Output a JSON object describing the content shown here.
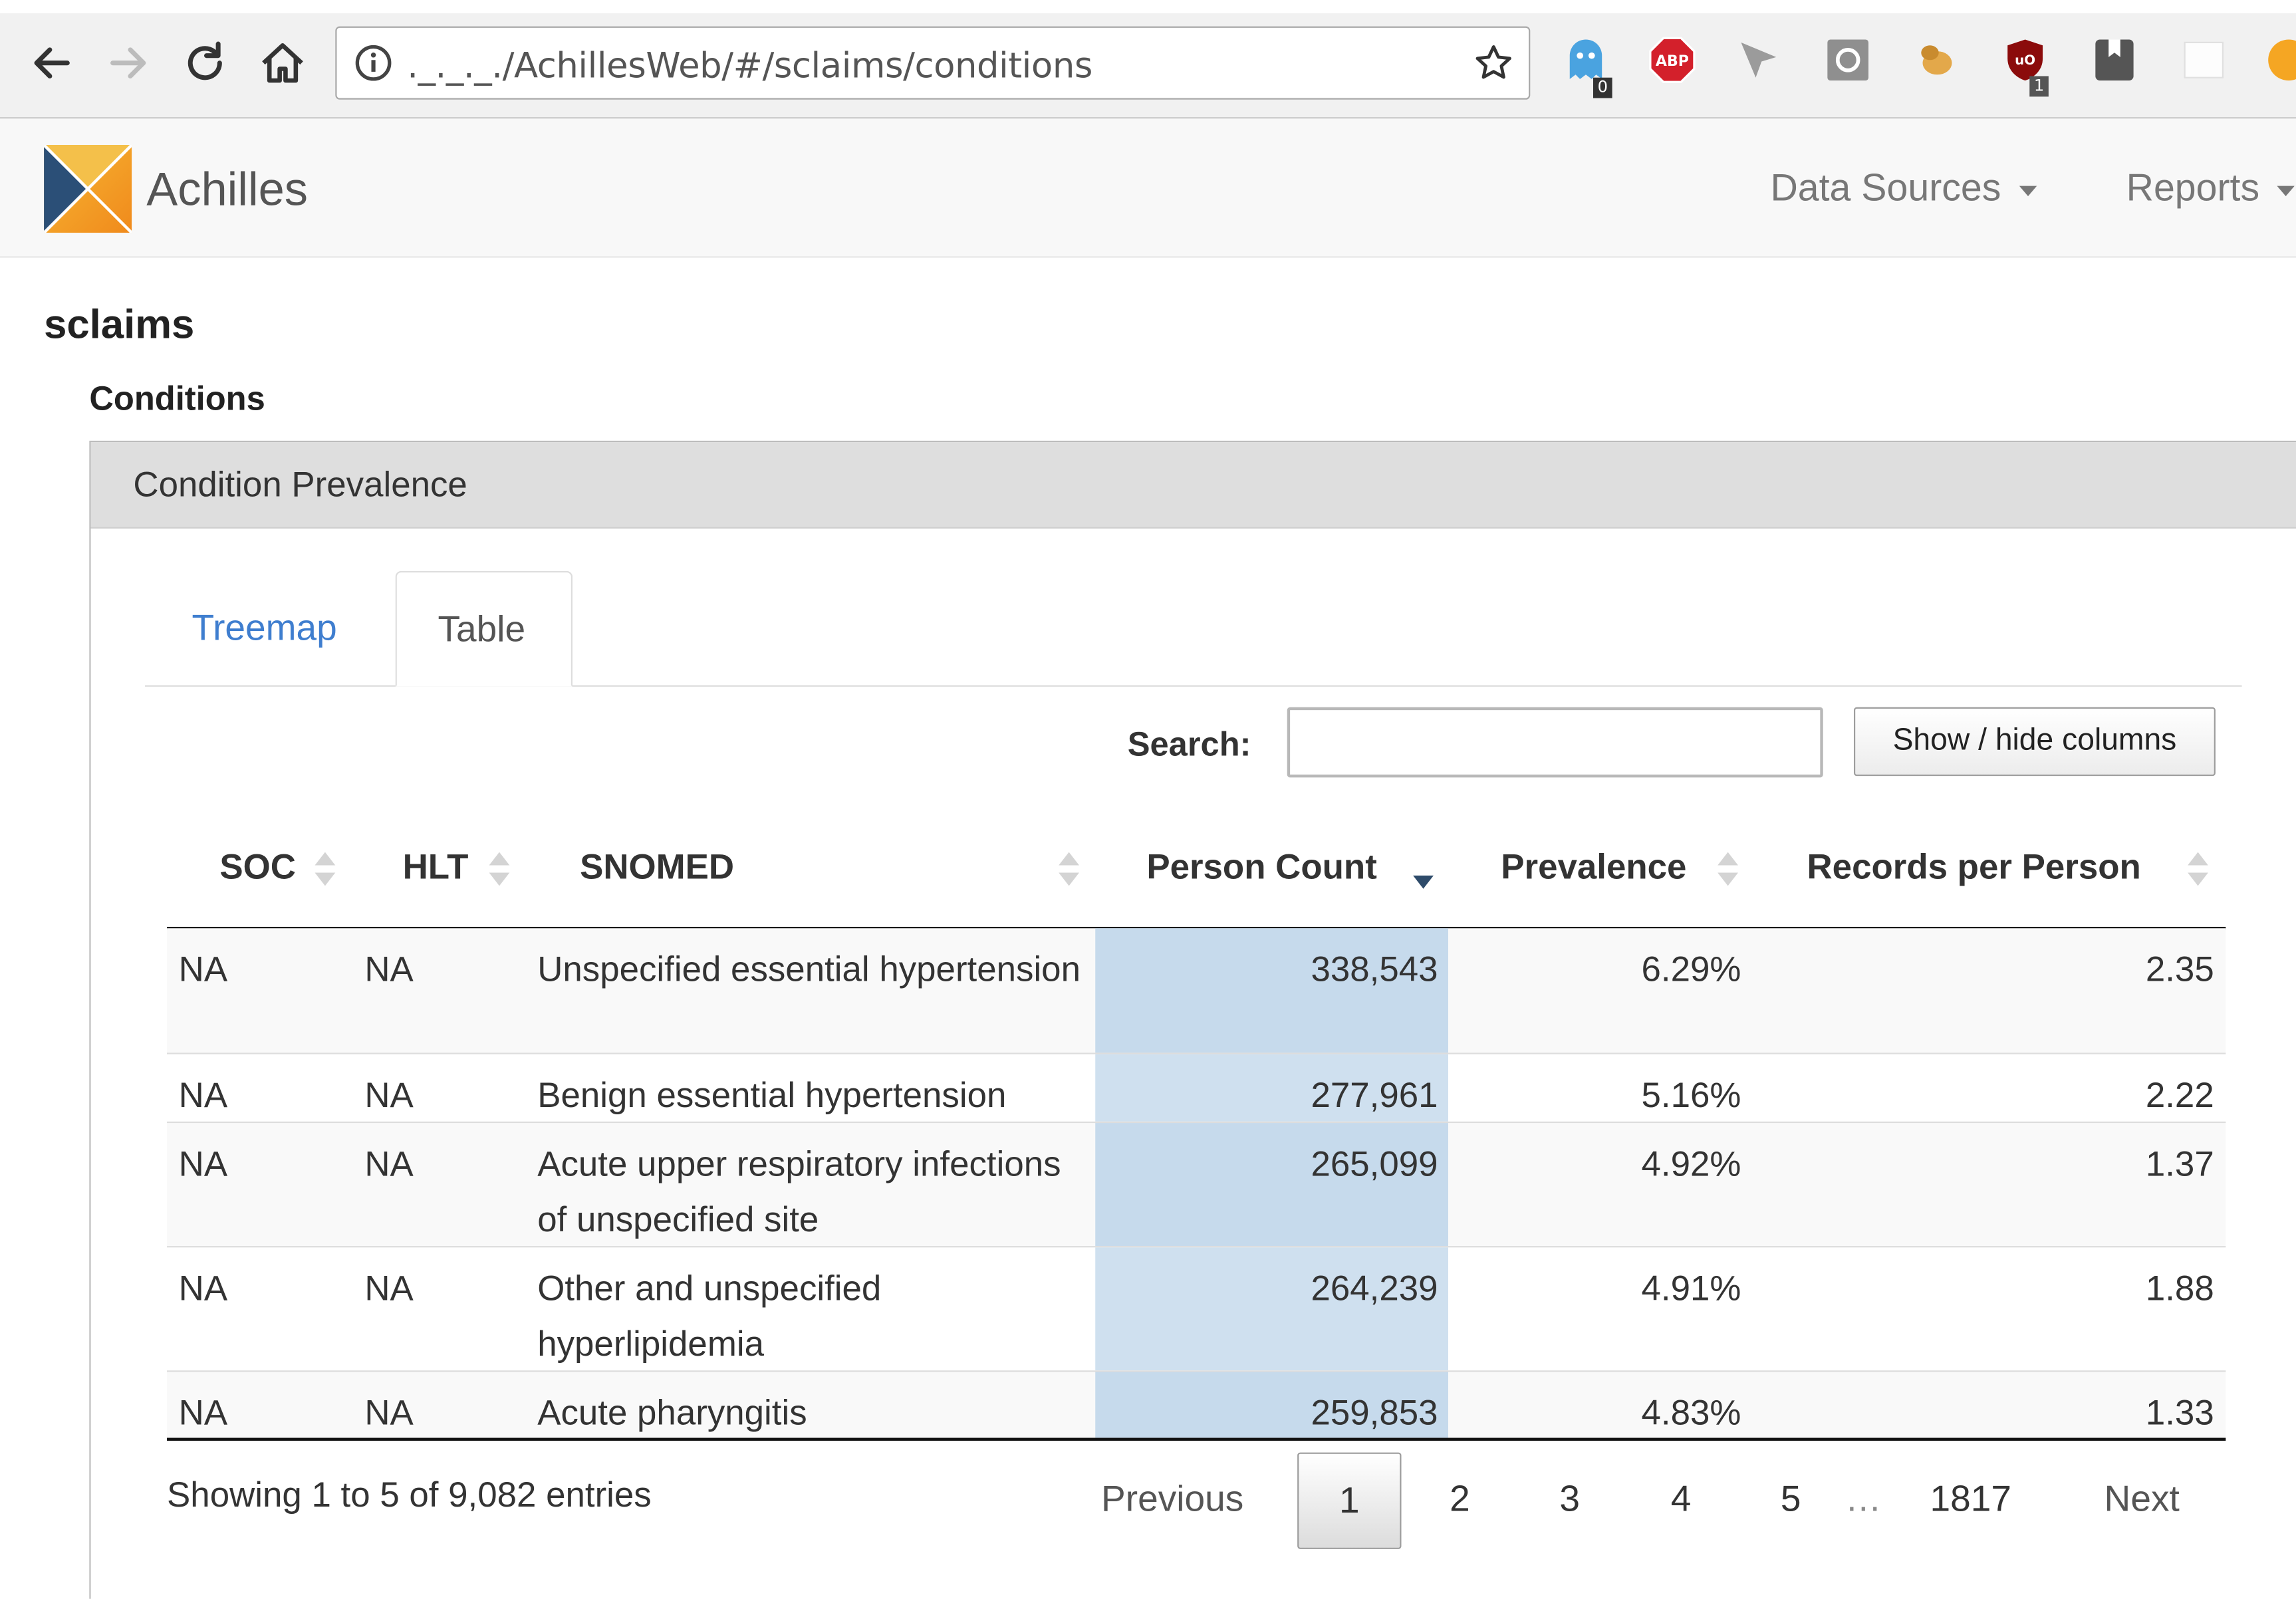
{
  "browser": {
    "url": "._._._./AchillesWeb/#/sclaims/conditions",
    "extensions": [
      {
        "name": "ghostery-icon",
        "badge": "0"
      },
      {
        "name": "adblock-plus-icon",
        "label": "ABP"
      },
      {
        "name": "cursor-extension-icon"
      },
      {
        "name": "screenshot-extension-icon"
      },
      {
        "name": "hand-extension-icon"
      },
      {
        "name": "ublock-icon",
        "badge": "1"
      },
      {
        "name": "bookmark-extension-icon"
      },
      {
        "name": "blank-extension-icon"
      },
      {
        "name": "orange-extension-icon"
      }
    ]
  },
  "navbar": {
    "brand": "Achilles",
    "data_sources_label": "Data Sources",
    "reports_label": "Reports"
  },
  "page": {
    "datasource_title": "sclaims",
    "section_title": "Conditions",
    "panel_title": "Condition Prevalence"
  },
  "tabs": [
    {
      "label": "Treemap",
      "active": false
    },
    {
      "label": "Table",
      "active": true
    }
  ],
  "search": {
    "label": "Search:",
    "value": ""
  },
  "columns_button_label": "Show / hide columns",
  "table": {
    "headers": [
      "SOC",
      "HLT",
      "SNOMED",
      "Person Count",
      "Prevalence",
      "Records per Person"
    ],
    "sorted_column": "Person Count",
    "rows": [
      {
        "soc": "NA",
        "hlt": "NA",
        "snomed": "Unspecified essential hypertension",
        "person_count": "338,543",
        "prevalence": "6.29%",
        "records_per_person": "2.35"
      },
      {
        "soc": "NA",
        "hlt": "NA",
        "snomed": "Benign essential hypertension",
        "person_count": "277,961",
        "prevalence": "5.16%",
        "records_per_person": "2.22"
      },
      {
        "soc": "NA",
        "hlt": "NA",
        "snomed": "Acute upper respiratory infections of unspecified site",
        "person_count": "265,099",
        "prevalence": "4.92%",
        "records_per_person": "1.37"
      },
      {
        "soc": "NA",
        "hlt": "NA",
        "snomed": "Other and unspecified hyperlipidemia",
        "person_count": "264,239",
        "prevalence": "4.91%",
        "records_per_person": "1.88"
      },
      {
        "soc": "NA",
        "hlt": "NA",
        "snomed": "Acute pharyngitis",
        "person_count": "259,853",
        "prevalence": "4.83%",
        "records_per_person": "1.33"
      }
    ]
  },
  "footer": {
    "info": "Showing 1 to 5 of 9,082 entries",
    "previous_label": "Previous",
    "next_label": "Next",
    "pages": [
      "1",
      "2",
      "3",
      "4",
      "5"
    ],
    "ellipsis": "…",
    "last_page": "1817",
    "current_page": "1"
  },
  "colors": {
    "link": "#3f7ecf",
    "sorted_column_bg": "#cfe0ef",
    "panel_heading_bg": "#dedede"
  }
}
